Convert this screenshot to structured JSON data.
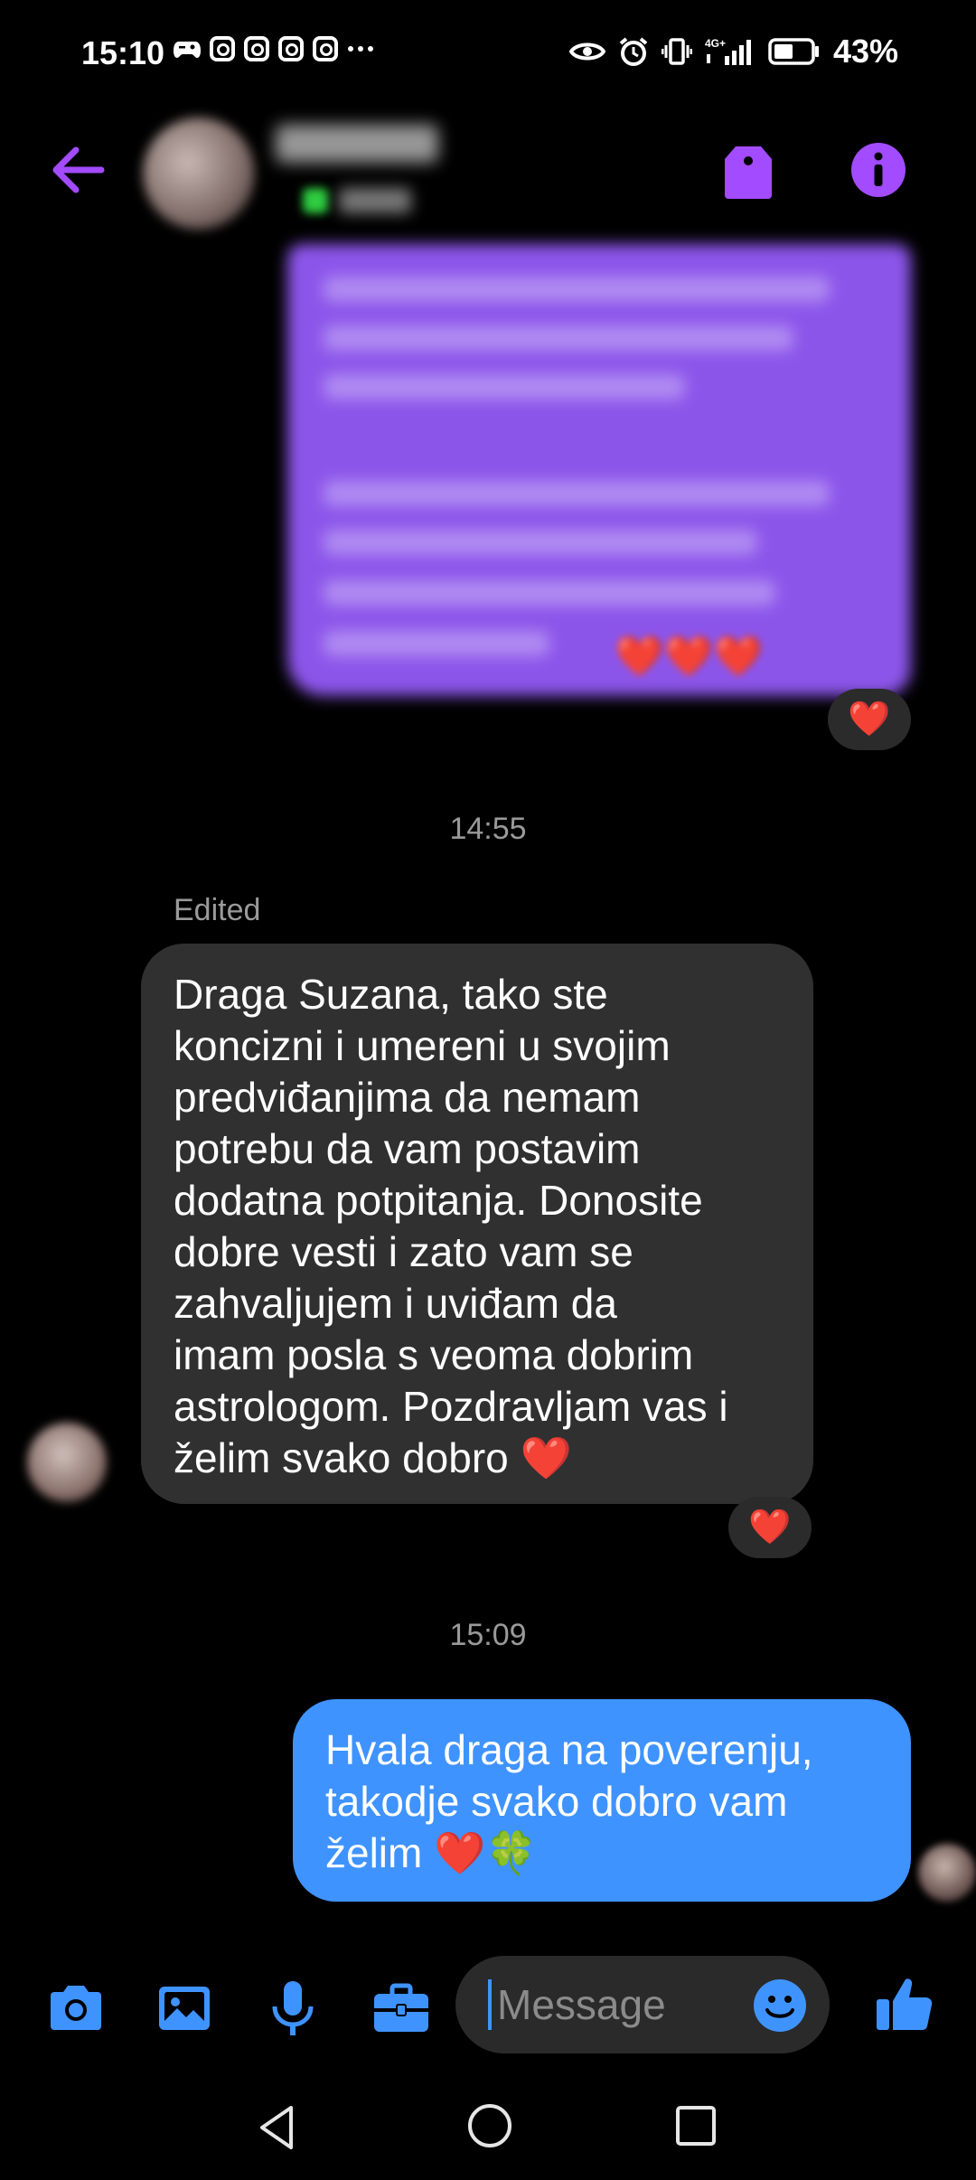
{
  "status_bar": {
    "time": "15:10",
    "battery": "43%",
    "icons": [
      "game-controller-icon",
      "instagram-icon",
      "instagram-icon",
      "instagram-icon",
      "instagram-icon",
      "more-dots-icon",
      "eye-icon",
      "alarm-icon",
      "vibrate-icon",
      "signal-4g-icon",
      "battery-icon"
    ]
  },
  "header": {
    "back_icon": "arrow-left-icon",
    "tag_icon": "tag-icon",
    "info_icon": "info-icon",
    "accent_color": "#a24bff"
  },
  "messages": {
    "reaction_1": "❤️",
    "timestamp_1": "14:55",
    "edited_label": "Edited",
    "incoming_text": "Draga Suzana, tako  ste\nkoncizni i umereni u svojim\npredviđanjima da nemam\npotrebu da vam postavim\ndodatna potpitanja. Donosite\ndobre vesti i zato vam se\nzahvaljujem i uviđam da\nimam posla s veoma dobrim\nastrologom. Pozdravljam vas i\nželim svako dobro ❤️",
    "reaction_2": "❤️",
    "timestamp_2": "15:09",
    "outgoing_text": "Hvala draga na poverenju,\ntakodje svako dobro vam\nželim ❤️🍀",
    "incoming_bubble_color": "#303030",
    "outgoing_bubble_color": "#3f93ff"
  },
  "composer": {
    "placeholder": "Message",
    "icons": [
      "camera-icon",
      "gallery-icon",
      "microphone-icon",
      "briefcase-icon",
      "emoji-icon",
      "thumbs-up-icon"
    ],
    "icon_color": "#3f93ff"
  },
  "nav_bar": {
    "icons": [
      "nav-back-icon",
      "nav-home-icon",
      "nav-recent-icon"
    ]
  }
}
